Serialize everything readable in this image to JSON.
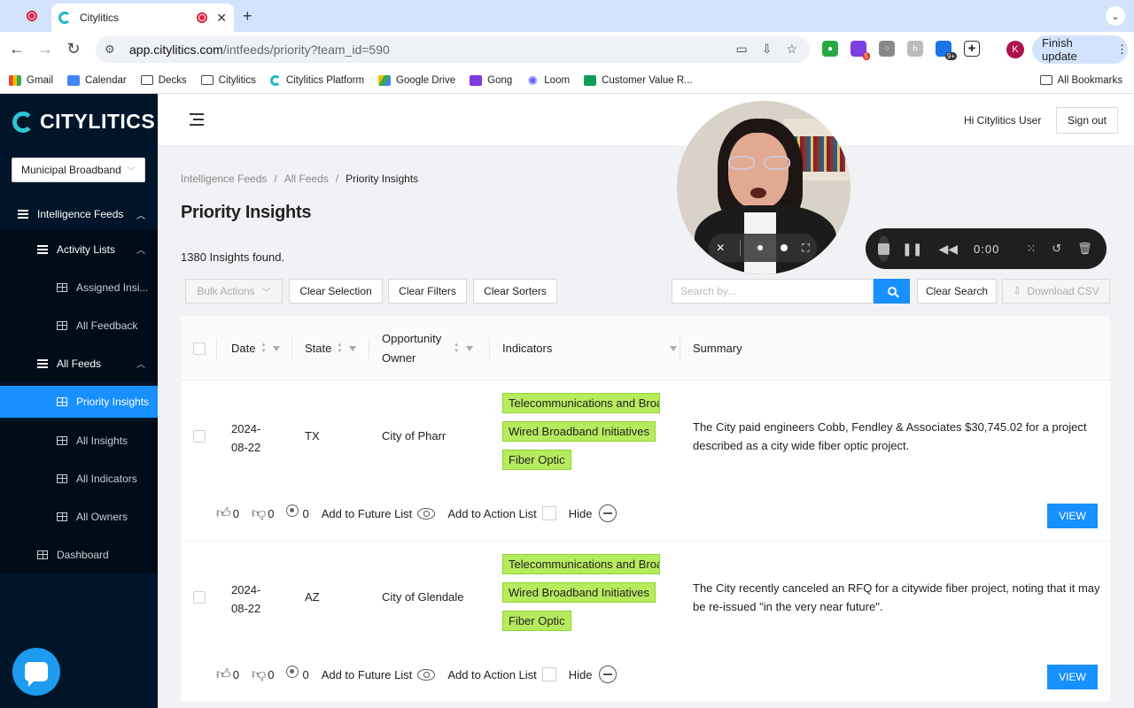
{
  "browser": {
    "tab_title": "Citylitics",
    "url_host": "app.citylitics.com",
    "url_path": "/intfeeds/priority?team_id=590",
    "finish_update_label": "Finish update",
    "profile_initial": "K",
    "ext_badge_1": "5",
    "ext_badge_2": "9+",
    "bookmarks": [
      "Gmail",
      "Calendar",
      "Decks",
      "Citylitics",
      "Citylitics Platform",
      "Google Drive",
      "Gong",
      "Loom",
      "Customer Value R..."
    ],
    "all_bookmarks": "All Bookmarks"
  },
  "sidebar": {
    "brand": "CITYLITICS",
    "team": "Municipal Broadband",
    "menu": {
      "intelligence_feeds": "Intelligence Feeds",
      "activity_lists": "Activity Lists",
      "assigned": "Assigned Insi...",
      "all_feedback": "All Feedback",
      "all_feeds": "All Feeds",
      "priority_insights": "Priority Insights",
      "all_insights": "All Insights",
      "all_indicators": "All Indicators",
      "all_owners": "All Owners",
      "dashboard": "Dashboard"
    }
  },
  "header": {
    "greeting": "Hi Citylitics User",
    "sign_out": "Sign out"
  },
  "breadcrumb": [
    "Intelligence Feeds",
    "All Feeds",
    "Priority Insights"
  ],
  "page": {
    "title": "Priority Insights",
    "count_text": "1380 Insights found."
  },
  "toolbar": {
    "bulk_actions": "Bulk Actions",
    "clear_selection": "Clear Selection",
    "clear_filters": "Clear Filters",
    "clear_sorters": "Clear Sorters",
    "search_placeholder": "Search by...",
    "clear_search": "Clear Search",
    "download_csv": "Download CSV"
  },
  "table": {
    "columns": {
      "date": "Date",
      "state": "State",
      "owner_line1": "Opportunity",
      "owner_line2": "Owner",
      "indicators": "Indicators",
      "summary": "Summary"
    },
    "rows": [
      {
        "date_line1": "2024-",
        "date_line2": "08-22",
        "state": "TX",
        "owner": "City of Pharr",
        "tags": [
          "Telecommunications and Broadband",
          "Wired Broadband Initiatives",
          "Fiber Optic"
        ],
        "summary": "The City paid engineers Cobb, Fendley & Associates $30,745.02 for a project described as a city wide fiber optic project.",
        "likes": "0",
        "dislikes": "0",
        "targets": "0"
      },
      {
        "date_line1": "2024-",
        "date_line2": "08-22",
        "state": "AZ",
        "owner": "City of Glendale",
        "tags": [
          "Telecommunications and Broadband",
          "Wired Broadband Initiatives",
          "Fiber Optic"
        ],
        "summary": "The City recently canceled an RFQ for a citywide fiber project, noting that it may be re-issued \"in the very near future\".",
        "likes": "0",
        "dislikes": "0",
        "targets": "0"
      }
    ],
    "actions": {
      "future_list": "Add to Future List",
      "action_list": "Add to Action List",
      "hide": "Hide",
      "view": "VIEW"
    }
  },
  "recorder": {
    "time": "0:00"
  },
  "colors": {
    "sidebar_bg": "#001529",
    "primary": "#1890ff",
    "tag_bg": "#b7eb5e",
    "brand_teal": "#2fc4d2"
  }
}
